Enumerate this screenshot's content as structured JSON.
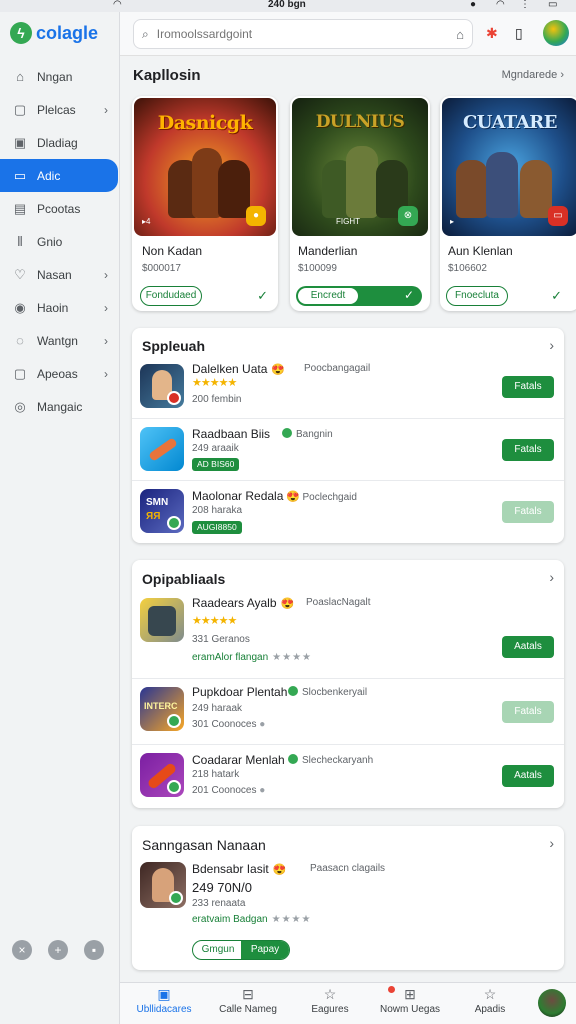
{
  "status": {
    "time": "240 bgn"
  },
  "app": {
    "logo": "colagle"
  },
  "sidebar": {
    "items": [
      {
        "label": "Nngan",
        "icon": "⌂",
        "chev": false
      },
      {
        "label": "Plelcas",
        "icon": "▢",
        "chev": true
      },
      {
        "label": "Dladiag",
        "icon": "▣",
        "chev": false
      },
      {
        "label": "Adic",
        "icon": "▭",
        "chev": false,
        "active": true
      },
      {
        "label": "Pcootas",
        "icon": "▤",
        "chev": false
      },
      {
        "label": "Gnio",
        "icon": "⫴",
        "chev": false
      },
      {
        "label": "Nasan",
        "icon": "♡",
        "chev": true
      },
      {
        "label": "Haoin",
        "icon": "◉",
        "chev": true
      },
      {
        "label": "Wantgn",
        "icon": "◌",
        "chev": true
      },
      {
        "label": "Apeoas",
        "icon": "▢",
        "chev": true
      },
      {
        "label": "Mangaic",
        "icon": "◎",
        "chev": false
      }
    ]
  },
  "search": {
    "placeholder": "Iromoolssardgoint"
  },
  "featured": {
    "title": "Kapllosin",
    "more": "Mgndarede",
    "cards": [
      {
        "art": "Dasnicgk",
        "name": "Non Kadan",
        "price": "$000017",
        "button": "Fondudaed",
        "action": "check"
      },
      {
        "art": "DULNIUS",
        "name": "Manderlian",
        "price": "$100099",
        "button": "Encredt",
        "action": "toggle"
      },
      {
        "art": "CUATARE",
        "name": "Aun Klenlan",
        "price": "$106602",
        "button": "Fnoecluta",
        "action": "check"
      }
    ]
  },
  "sections": [
    {
      "title": "Sppleuah",
      "rows": [
        {
          "title": "Dalelken Uata",
          "publisher": "Poocbangagail",
          "stars": "★★★★★",
          "meta": "200 fembin",
          "button": "Fatals",
          "disabled": false
        },
        {
          "title": "Raadbaan Biis",
          "publisher": "Bangnin",
          "meta": "249 araaik",
          "chip": "AD BIS60",
          "button": "Fatals",
          "disabled": false
        },
        {
          "title": "Maolonar Redala",
          "publisher": "Poclechgaid",
          "meta": "208 haraka",
          "chip": "AUGI8850",
          "button": "Fatals",
          "disabled": true
        }
      ]
    },
    {
      "title": "Opipabliaals",
      "rows": [
        {
          "title": "Raadears Ayalb",
          "publisher": "PoaslacNagalt",
          "stars": "★★★★★",
          "meta": "331 Geranos",
          "extra": "eramAlor flangan",
          "extra_stars": "★★★★",
          "button": "Aatals",
          "disabled": false
        },
        {
          "title": "Pupkdoar Plentah",
          "publisher": "Slocbenkeryail",
          "meta": "249 haraak",
          "meta2": "301 Coonoces",
          "button": "Fatals",
          "disabled": true
        },
        {
          "title": "Coadarar Menlah",
          "publisher": "Slecheckaryanh",
          "meta": "218 hatark",
          "meta2": "201 Coonoces",
          "button": "Aatals",
          "disabled": false
        }
      ]
    },
    {
      "title": "Sanngasan Nanaan",
      "row": {
        "title": "Bdensabr Iasit",
        "publisher": "Paasacn clagails",
        "price": "249 70N/0",
        "meta": "233 renaata",
        "extra": "eratvaim Badgan",
        "extra_stars": "★★★★",
        "step_left": "Gmgun",
        "step_right": "Papay"
      }
    }
  ],
  "bottom_nav": [
    {
      "label": "Ubllidacares",
      "icon": "▣",
      "active": true
    },
    {
      "label": "Calle Nameg",
      "icon": "⊟",
      "active": false
    },
    {
      "label": "Eagures",
      "icon": "☆",
      "active": false
    },
    {
      "label": "Nowm Uegas",
      "icon": "⊞",
      "active": false
    },
    {
      "label": "Apadis",
      "icon": "☆",
      "active": false
    }
  ],
  "colors": {
    "accent": "#1a73e8",
    "install_green": "#1e8e3e",
    "star": "#f4b400"
  }
}
